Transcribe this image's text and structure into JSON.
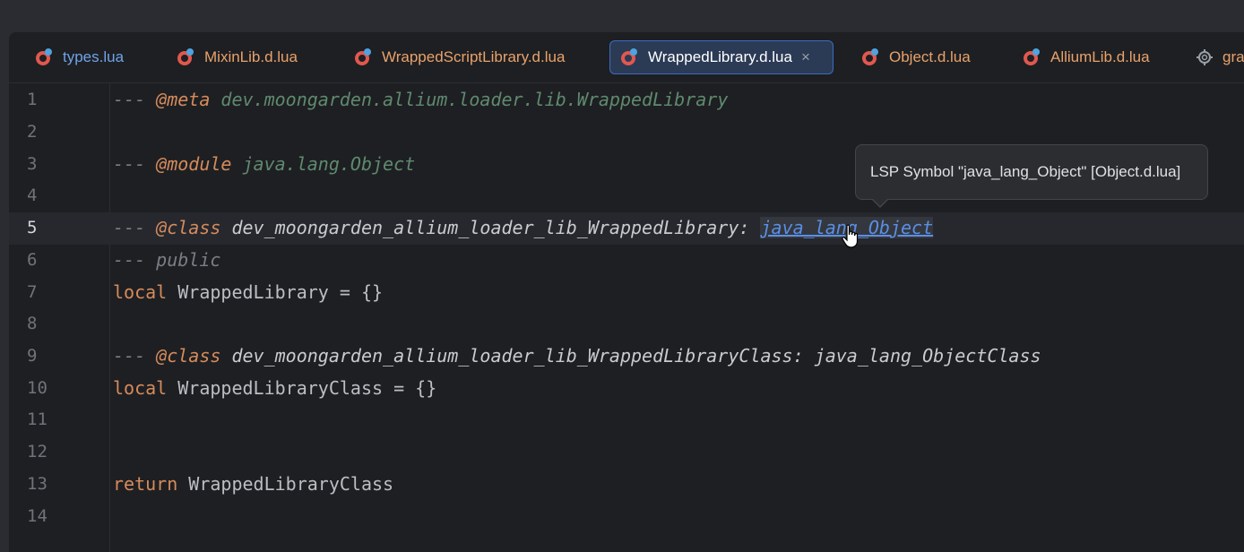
{
  "tabs": [
    {
      "label": "types.lua",
      "color": "blue",
      "active": false
    },
    {
      "label": "MixinLib.d.lua",
      "color": "orange",
      "active": false
    },
    {
      "label": "WrappedScriptLibrary.d.lua",
      "color": "orange",
      "active": false
    },
    {
      "label": "WrappedLibrary.d.lua",
      "color": "white",
      "active": true,
      "close": "×"
    },
    {
      "label": "Object.d.lua",
      "color": "orange",
      "active": false
    },
    {
      "label": "AlliumLib.d.lua",
      "color": "orange",
      "active": false
    },
    {
      "label": "gra",
      "color": "orange",
      "active": false,
      "icon": "gear-icon"
    }
  ],
  "lines": [
    {
      "n": "1",
      "a": "--- ",
      "b": "@meta",
      "c": " dev.moongarden.allium.loader.lib.WrappedLibrary"
    },
    {
      "n": "2"
    },
    {
      "n": "3",
      "a": "--- ",
      "b": "@module",
      "c": " java.lang.Object"
    },
    {
      "n": "4"
    },
    {
      "n": "5",
      "a": "--- ",
      "b": "@class",
      "c": " dev_moongarden_allium_loader_lib_WrappedLibrary: ",
      "d": "java_lang_Object"
    },
    {
      "n": "6",
      "a": "--- public"
    },
    {
      "n": "7",
      "a": "local",
      "c": " WrappedLibrary = {}"
    },
    {
      "n": "8"
    },
    {
      "n": "9",
      "a": "--- ",
      "b": "@class",
      "c": " dev_moongarden_allium_loader_lib_WrappedLibraryClass: java_lang_ObjectClass"
    },
    {
      "n": "10",
      "a": "local",
      "c": " WrappedLibraryClass = {}"
    },
    {
      "n": "11"
    },
    {
      "n": "12"
    },
    {
      "n": "13",
      "a": "return",
      "c": " WrappedLibraryClass"
    },
    {
      "n": "14"
    }
  ],
  "tooltip": "LSP Symbol \"java_lang_Object\" [Object.d.lua]",
  "colors": {
    "accent": "#3b6cc2",
    "keyword": "#d58b5c",
    "link": "#5a8fe6"
  }
}
